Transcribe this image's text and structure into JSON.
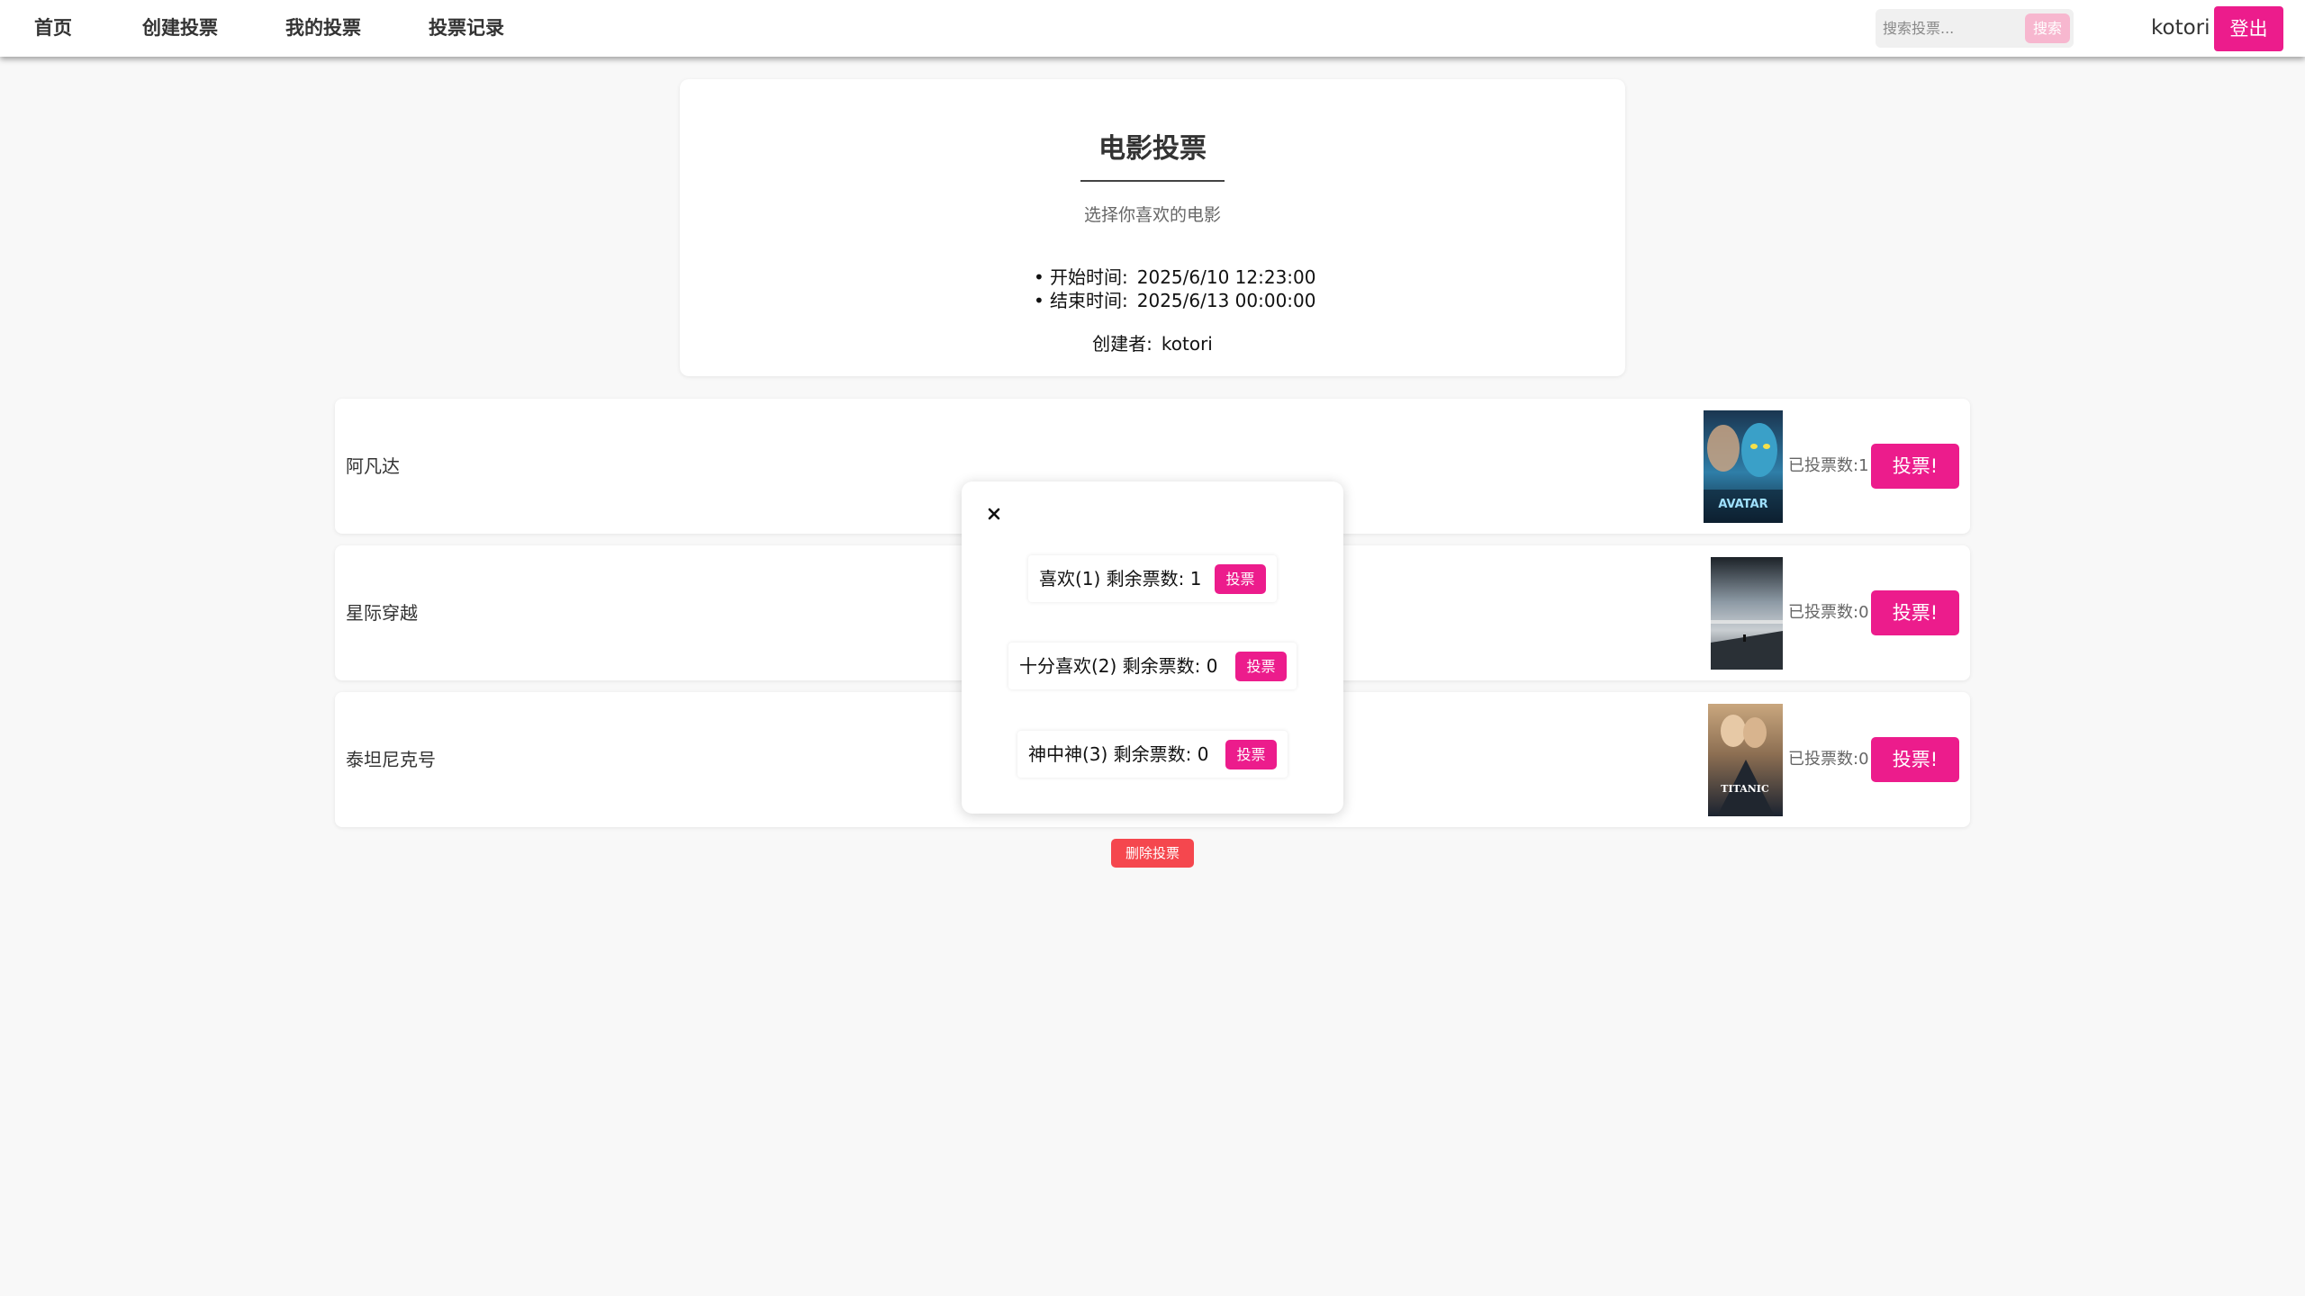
{
  "nav": {
    "links": [
      "首页",
      "创建投票",
      "我的投票",
      "投票记录"
    ],
    "search_placeholder": "搜索投票...",
    "search_button": "搜索",
    "username": "kotori",
    "logout": "登出"
  },
  "vote": {
    "title": "电影投票",
    "description": "选择你喜欢的电影",
    "start_label": "开始时间:",
    "start_time": "2025/6/10 12:23:00",
    "end_label": "结束时间:",
    "end_time": "2025/6/13 00:00:00",
    "creator_label": "创建者:",
    "creator": "kotori"
  },
  "movies": [
    {
      "name": "阿凡达",
      "count_text": "已投票数:1",
      "button": "投票!",
      "poster": "avatar"
    },
    {
      "name": "星际穿越",
      "count_text": "已投票数:0",
      "button": "投票!",
      "poster": "interstellar"
    },
    {
      "name": "泰坦尼克号",
      "count_text": "已投票数:0",
      "button": "投票!",
      "poster": "titanic"
    }
  ],
  "poster_text": {
    "avatar": "AVATAR",
    "titanic": "TITANIC"
  },
  "delete_button": "删除投票",
  "modal": {
    "close_icon": "close-icon",
    "options": [
      {
        "text": "喜欢(1) 剩余票数: 1",
        "button": "投票"
      },
      {
        "text": "十分喜欢(2) 剩余票数: 0",
        "button": "投票"
      },
      {
        "text": "神中神(3) 剩余票数: 0",
        "button": "投票"
      }
    ]
  },
  "colors": {
    "accent": "#ec1c8c",
    "search_button": "#f7b7cf",
    "danger": "#f5474e",
    "background": "#f8f8f8"
  }
}
